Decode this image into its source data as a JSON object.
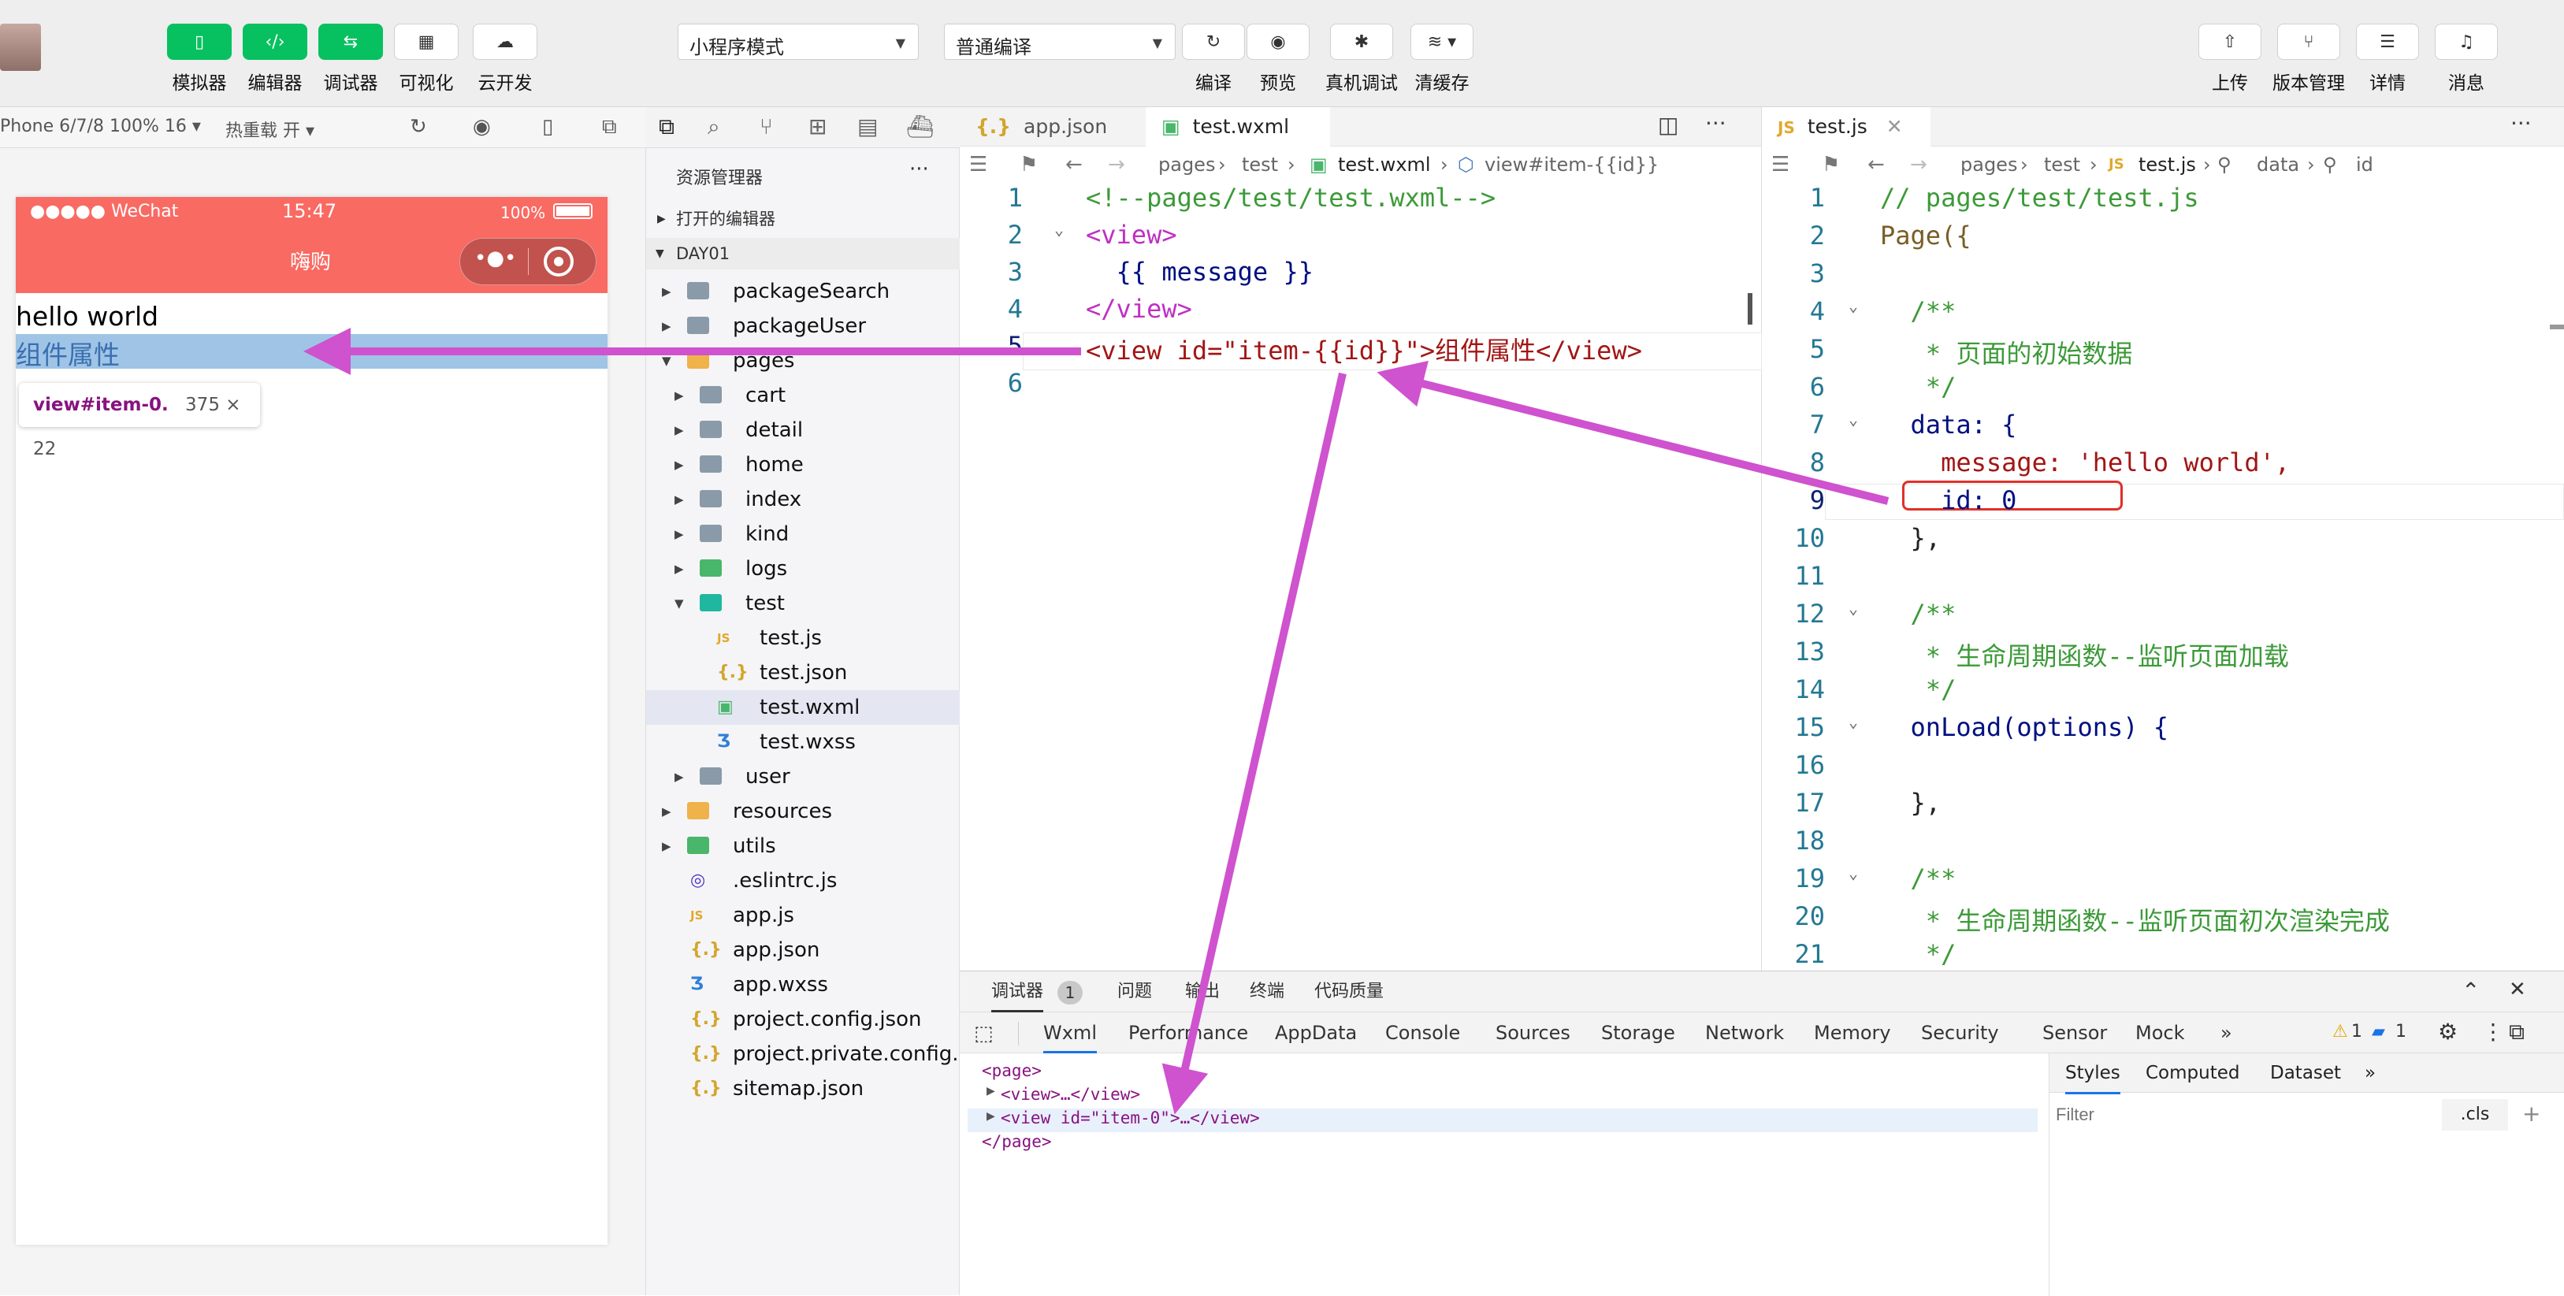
{
  "toolbar": {
    "left_buttons": [
      {
        "label": "模拟器",
        "icon": "phone-icon"
      },
      {
        "label": "编辑器",
        "icon": "code-icon"
      },
      {
        "label": "调试器",
        "icon": "debug-toggle-icon"
      },
      {
        "label": "可视化",
        "icon": "layout-icon"
      },
      {
        "label": "云开发",
        "icon": "cloud-icon"
      }
    ],
    "mode_select": "小程序模式",
    "compile_select": "普通编译",
    "center_buttons": [
      {
        "label": "编译",
        "icon": "refresh-icon"
      },
      {
        "label": "预览",
        "icon": "eye-icon"
      },
      {
        "label": "真机调试",
        "icon": "bug-icon"
      },
      {
        "label": "清缓存",
        "icon": "layers-icon"
      }
    ],
    "right_buttons": [
      {
        "label": "上传",
        "icon": "upload-icon"
      },
      {
        "label": "版本管理",
        "icon": "branch-icon"
      },
      {
        "label": "详情",
        "icon": "menu-icon"
      },
      {
        "label": "消息",
        "icon": "bell-icon"
      }
    ]
  },
  "simulator": {
    "device": "Phone 6/7/8 100% 16 ▾",
    "hot_reload": "热重载 开 ▾",
    "status_signal": "●●●●● WeChat",
    "status_time": "15:47",
    "status_battery": "100%",
    "nav_title": "嗨购",
    "nav_color": "#f96a63",
    "line1": "hello world",
    "line2": "组件属性",
    "tooltip_selector": "view#item-0.",
    "tooltip_size": "375 × 22"
  },
  "explorer": {
    "title": "资源管理器",
    "open_editors": "打开的编辑器",
    "root": "DAY01",
    "items": [
      {
        "name": "packageSearch",
        "type": "folder",
        "depth": 1
      },
      {
        "name": "packageUser",
        "type": "folder",
        "depth": 1
      },
      {
        "name": "pages",
        "type": "folder-orange",
        "depth": 1,
        "open": true
      },
      {
        "name": "cart",
        "type": "folder",
        "depth": 2
      },
      {
        "name": "detail",
        "type": "folder",
        "depth": 2
      },
      {
        "name": "home",
        "type": "folder",
        "depth": 2
      },
      {
        "name": "index",
        "type": "folder",
        "depth": 2
      },
      {
        "name": "kind",
        "type": "folder",
        "depth": 2
      },
      {
        "name": "logs",
        "type": "folder-green",
        "depth": 2
      },
      {
        "name": "test",
        "type": "folder-teal",
        "depth": 2,
        "open": true
      },
      {
        "name": "test.js",
        "type": "js",
        "depth": 3
      },
      {
        "name": "test.json",
        "type": "json",
        "depth": 3
      },
      {
        "name": "test.wxml",
        "type": "wxml",
        "depth": 3,
        "selected": true
      },
      {
        "name": "test.wxss",
        "type": "wxss",
        "depth": 3
      },
      {
        "name": "user",
        "type": "folder",
        "depth": 2
      },
      {
        "name": "resources",
        "type": "folder-orange",
        "depth": 1
      },
      {
        "name": "utils",
        "type": "folder-green",
        "depth": 1
      },
      {
        "name": ".eslintrc.js",
        "type": "eslint",
        "depth": 1
      },
      {
        "name": "app.js",
        "type": "js",
        "depth": 1
      },
      {
        "name": "app.json",
        "type": "json",
        "depth": 1
      },
      {
        "name": "app.wxss",
        "type": "wxss",
        "depth": 1
      },
      {
        "name": "project.config.json",
        "type": "json",
        "depth": 1
      },
      {
        "name": "project.private.config...",
        "type": "json",
        "depth": 1
      },
      {
        "name": "sitemap.json",
        "type": "json",
        "depth": 1
      }
    ]
  },
  "editor1": {
    "tabs": [
      "app.json",
      "test.wxml"
    ],
    "breadcrumb": [
      "pages",
      "test",
      "test.wxml",
      "view#item-{{id}}"
    ],
    "line_numbers": [
      "1",
      "2",
      "3",
      "4",
      "5",
      "6"
    ],
    "lines": [
      "<!--pages/test/test.wxml-->",
      "<view>",
      "  {{ message }}",
      "</view>",
      "<view id=\"item-{{id}}\">组件属性</view>",
      ""
    ]
  },
  "editor2": {
    "tabs": [
      "test.js"
    ],
    "breadcrumb": [
      "pages",
      "test",
      "test.js",
      "data",
      "id"
    ],
    "line_numbers": [
      "1",
      "2",
      "3",
      "4",
      "5",
      "6",
      "7",
      "8",
      "9",
      "10",
      "11",
      "12",
      "13",
      "14",
      "15",
      "16",
      "17",
      "18",
      "19",
      "20",
      "21"
    ],
    "lines": [
      "// pages/test/test.js",
      "Page({",
      "",
      "  /**",
      "   * 页面的初始数据",
      "   */",
      "  data: {",
      "    message: 'hello world',",
      "    id: 0",
      "  },",
      "",
      "  /**",
      "   * 生命周期函数--监听页面加载",
      "   */",
      "  onLoad(options) {",
      "",
      "  },",
      "",
      "  /**",
      "   * 生命周期函数--监听页面初次渲染完成",
      "   */"
    ]
  },
  "devtools": {
    "top_tabs": [
      "调试器",
      "问题",
      "输出",
      "终端",
      "代码质量"
    ],
    "badge": "1",
    "panel_tabs": [
      "Wxml",
      "Performance",
      "AppData",
      "Console",
      "Sources",
      "Storage",
      "Network",
      "Memory",
      "Security",
      "Sensor",
      "Mock"
    ],
    "more": "»",
    "warn_count": "1",
    "info_count": "1",
    "wxml_lines": [
      "<page>",
      "<view>…</view>",
      "<view id=\"item-0\">…</view>",
      "</page>"
    ],
    "styles_tabs": [
      "Styles",
      "Computed",
      "Dataset"
    ],
    "filter_placeholder": "Filter",
    "cls": ".cls",
    "plus": "+"
  },
  "colors": {
    "accent_green": "#07c160",
    "annotation": "#cf52cf",
    "highlight_box": "#e0302a"
  }
}
